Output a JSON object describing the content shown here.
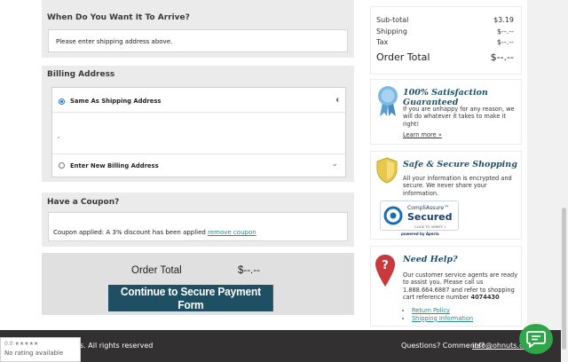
{
  "arrive": {
    "title": "When Do You Want It To Arrive?",
    "message": "Please enter shipping address above."
  },
  "billing": {
    "title": "Billing Address",
    "option_same": "Same As Shipping Address",
    "address_text": ",",
    "option_new": "Enter New Billing Address"
  },
  "coupon": {
    "title": "Have a Coupon?",
    "applied_text": "Coupon applied: A 3% discount has been applied",
    "remove_link": "remove coupon"
  },
  "order": {
    "total_label": "Order Total",
    "total_value": "$--.--",
    "pay_button": "Continue to Secure Payment Form"
  },
  "totals": {
    "subtotal_label": "Sub-total",
    "subtotal_value": "$3.19",
    "shipping_label": "Shipping",
    "shipping_value": "$--.--",
    "tax_label": "Tax",
    "tax_value": "$--.--",
    "order_total_label": "Order Total",
    "order_total_value": "$--.--"
  },
  "satisfaction": {
    "title": "100% Satisfaction Guaranteed",
    "text": "If you are unhappy for any reason, we will do whatever it takes to make it right!",
    "link": "Learn more »"
  },
  "secure": {
    "title": "Safe & Secure Shopping",
    "text": "All your information is encrypted and secure. We never share your information.",
    "badge_brand": "CompliAssure™",
    "badge_secured": "Secured",
    "badge_click": "CLICK TO VERIFY »",
    "badge_powered": "powered by Aperia"
  },
  "help": {
    "title": "Need Help?",
    "text_1": "Our customer service agents are ready to assist you. Please call us 1.888.664.6887 and refer to shopping cart reference number",
    "ref_number": "4074430",
    "link_return": "Return Policy",
    "link_shipping": "Shipping Information"
  },
  "footer": {
    "rights": "s. All rights reserved",
    "questions": "Questions? Comments?",
    "email": "info@ohnuts.com"
  },
  "rating_widget": {
    "score": "0.0 ★★★★★",
    "text": "No rating available"
  },
  "colors": {
    "primary_button": "#1f4f63",
    "link": "#2a8a8c",
    "chat": "#2fa64a",
    "footer": "#333031"
  }
}
